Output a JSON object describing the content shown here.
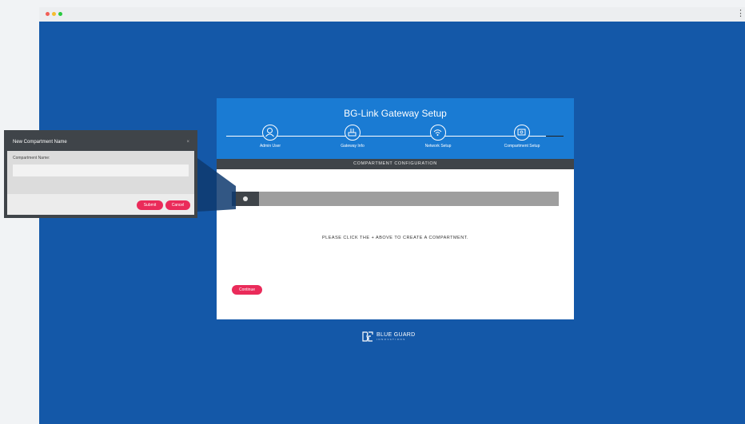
{
  "browser": {
    "menu_glyph": "⋮"
  },
  "setup": {
    "title": "BG-Link Gateway Setup",
    "steps": [
      {
        "label": "Admin User",
        "icon": "user-icon"
      },
      {
        "label": "Gateway Info",
        "icon": "router-icon"
      },
      {
        "label": "Network Setup",
        "icon": "wifi-icon"
      },
      {
        "label": "Compartment Setup",
        "icon": "compartment-icon"
      }
    ],
    "section_title": "COMPARTMENT CONFIGURATION",
    "hint": "PLEASE CLICK THE + ABOVE TO CREATE A COMPARTMENT.",
    "continue_label": "Continue"
  },
  "brand": {
    "name": "BLUE GUARD",
    "sub": "INNOVATIONS",
    "mark": "BG"
  },
  "modal": {
    "title": "New Compartment Name",
    "close": "×",
    "field_label": "Compartment Name:",
    "field_value": "",
    "submit_label": "Submit",
    "cancel_label": "Cancel"
  },
  "colors": {
    "page_bg": "#1458a8",
    "header_bg": "#1a7bd3",
    "dark_bar": "#3f4449",
    "accent": "#ea2b5a"
  }
}
